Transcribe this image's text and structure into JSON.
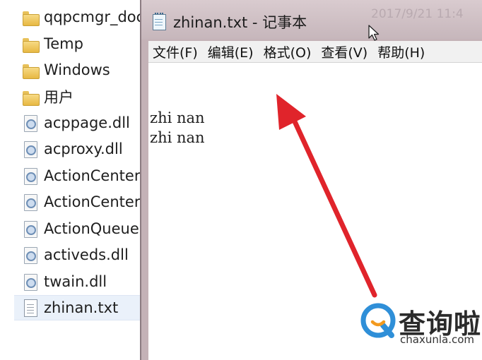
{
  "explorer": {
    "items": [
      {
        "label": "qqpcmgr_doc",
        "icon": "folder-icon"
      },
      {
        "label": "Temp",
        "icon": "folder-icon"
      },
      {
        "label": "Windows",
        "icon": "folder-icon"
      },
      {
        "label": "用户",
        "icon": "folder-icon"
      },
      {
        "label": "acppage.dll",
        "icon": "dll-file-icon"
      },
      {
        "label": "acproxy.dll",
        "icon": "dll-file-icon"
      },
      {
        "label": "ActionCenter.",
        "icon": "dll-file-icon"
      },
      {
        "label": "ActionCenterC",
        "icon": "dll-file-icon"
      },
      {
        "label": "ActionQueue.",
        "icon": "dll-file-icon"
      },
      {
        "label": "activeds.dll",
        "icon": "dll-file-icon"
      },
      {
        "label": "twain.dll",
        "icon": "dll-file-icon"
      },
      {
        "label": "zhinan.txt",
        "icon": "text-file-icon",
        "selected": true
      }
    ]
  },
  "notepad": {
    "title": "zhinan.txt - 记事本",
    "background_timestamp": "2017/9/21 11:4",
    "menu": [
      "文件(F)",
      "编辑(E)",
      "格式(O)",
      "查看(V)",
      "帮助(H)"
    ],
    "content": "zhi nan\nzhi nan"
  },
  "annotation": {
    "color": "#e0242b",
    "icon": "red-arrow-icon"
  },
  "watermark": {
    "text": "查询啦",
    "url": "chaxunla.com",
    "logo_color": "#2f8fd8",
    "logo_accent": "#f39a1e"
  }
}
